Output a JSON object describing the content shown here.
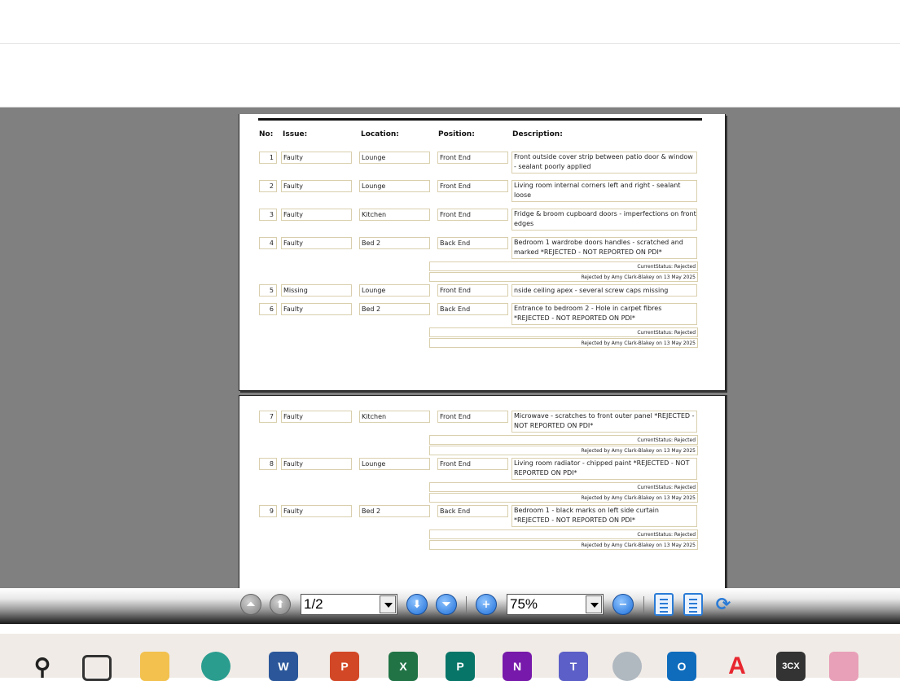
{
  "columns": {
    "no": "No:",
    "issue": "Issue:",
    "location": "Location:",
    "position": "Position:",
    "description": "Description:"
  },
  "page1_rows": [
    {
      "no": "1",
      "issue": "Faulty",
      "location": "Lounge",
      "position": "Front End",
      "description": "Front outside cover strip between patio door & window - sealant poorly applied"
    },
    {
      "no": "2",
      "issue": "Faulty",
      "location": "Lounge",
      "position": "Front End",
      "description": "Living room internal corners left and right - sealant loose"
    },
    {
      "no": "3",
      "issue": "Faulty",
      "location": "Kitchen",
      "position": "Front End",
      "description": "Fridge & broom cupboard doors - imperfections on front edges"
    },
    {
      "no": "4",
      "issue": "Faulty",
      "location": "Bed 2",
      "position": "Back End",
      "description": "Bedroom 1 wardrobe doors handles - scratched and marked *REJECTED - NOT REPORTED ON PDI*",
      "status": "CurrentStatus: Rejected",
      "rejected": "Rejected by Amy Clark-Blakey on 13 May 2025"
    },
    {
      "no": "5",
      "issue": "Missing",
      "location": "Lounge",
      "position": "Front End",
      "description": "nside ceiling apex - several screw caps missing"
    },
    {
      "no": "6",
      "issue": "Faulty",
      "location": "Bed 2",
      "position": "Back End",
      "description": "Entrance to bedroom 2 - Hole in carpet fibres *REJECTED - NOT REPORTED ON PDI*",
      "status": "CurrentStatus: Rejected",
      "rejected": "Rejected by Amy Clark-Blakey on 13 May 2025"
    }
  ],
  "page2_rows": [
    {
      "no": "7",
      "issue": "Faulty",
      "location": "Kitchen",
      "position": "Front End",
      "description": "Microwave - scratches to front outer panel *REJECTED - NOT REPORTED ON PDI*",
      "status": "CurrentStatus: Rejected",
      "rejected": "Rejected by Amy Clark-Blakey on 13 May 2025"
    },
    {
      "no": "8",
      "issue": "Faulty",
      "location": "Lounge",
      "position": "Front End",
      "description": "Living room radiator - chipped paint *REJECTED - NOT REPORTED ON PDI*",
      "status": "CurrentStatus: Rejected",
      "rejected": "Rejected by Amy Clark-Blakey on 13 May 2025"
    },
    {
      "no": "9",
      "issue": "Faulty",
      "location": "Bed 2",
      "position": "Back End",
      "description": "Bedroom 1 - black marks on left side curtain *REJECTED - NOT REPORTED ON PDI*",
      "status": "CurrentStatus: Rejected",
      "rejected": "Rejected by Amy Clark-Blakey on 13 May 2025"
    }
  ],
  "toolbar": {
    "page_value": "1/2",
    "zoom_value": "75%"
  },
  "taskbar_icons": [
    {
      "name": "search-icon",
      "label": ""
    },
    {
      "name": "task-view-icon",
      "label": ""
    },
    {
      "name": "file-explorer-icon",
      "label": ""
    },
    {
      "name": "edge-icon",
      "label": ""
    },
    {
      "name": "word-icon",
      "label": "W"
    },
    {
      "name": "powerpoint-icon",
      "label": "P"
    },
    {
      "name": "excel-icon",
      "label": "X"
    },
    {
      "name": "publisher-icon",
      "label": "P"
    },
    {
      "name": "onenote-icon",
      "label": "N"
    },
    {
      "name": "teams-icon",
      "label": "T"
    },
    {
      "name": "app-circle-icon",
      "label": ""
    },
    {
      "name": "outlook-icon",
      "label": "O"
    },
    {
      "name": "acrobat-icon",
      "label": ""
    },
    {
      "name": "3cx-icon",
      "label": "3CX"
    },
    {
      "name": "copilot-icon",
      "label": ""
    }
  ],
  "colors": {
    "viewer_bg": "#808080",
    "cell_border": "#d9cfad",
    "accent_blue": "#1e6fd8"
  }
}
